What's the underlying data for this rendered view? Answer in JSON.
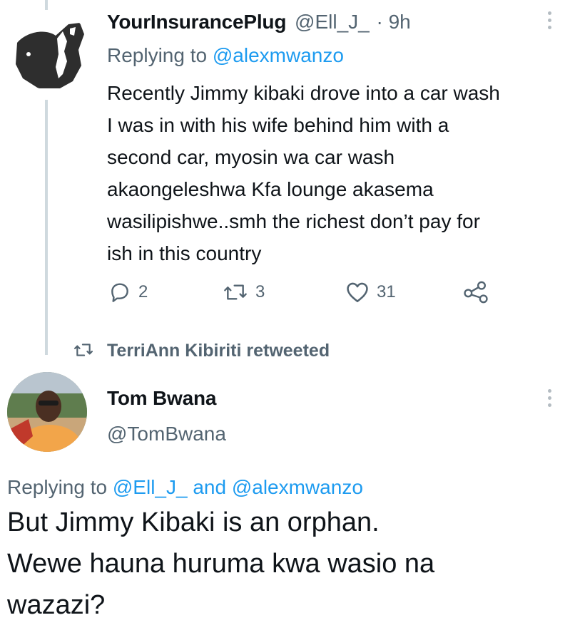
{
  "tweet1": {
    "display_name": "YourInsurancePlug",
    "handle": "@Ell_J_",
    "separator": "·",
    "time": "9h",
    "replying_prefix": "Replying to",
    "replying_to": "@alexmwanzo",
    "text_lines": [
      "Recently Jimmy kibaki drove into a car wash",
      "I was in with his wife behind him with a",
      "second car, myosin wa car wash",
      "akaongeleshwa Kfa lounge akasema",
      "wasilipishwe..smh the richest don’t pay for",
      "ish in this country"
    ],
    "replies": "2",
    "retweets": "3",
    "likes": "31"
  },
  "retweet_banner": {
    "text": "TerriAnn Kibiriti retweeted"
  },
  "tweet2": {
    "display_name": "Tom Bwana",
    "handle": "@TomBwana",
    "replying_prefix": "Replying to",
    "replying_to_1": "@Ell_J_",
    "replying_and": "and",
    "replying_to_2": "@alexmwanzo",
    "text_lines": [
      "But Jimmy Kibaki is an orphan.",
      "Wewe hauna huruma kwa wasio na",
      "wazazi?"
    ]
  },
  "icons": {
    "reply": "reply-icon",
    "retweet": "retweet-icon",
    "like": "heart-icon",
    "share": "share-icon",
    "more": "more-icon"
  },
  "colors": {
    "link": "#1d9bf0",
    "muted": "#536471",
    "text": "#0f1419",
    "thread_line": "#cfd9de"
  }
}
